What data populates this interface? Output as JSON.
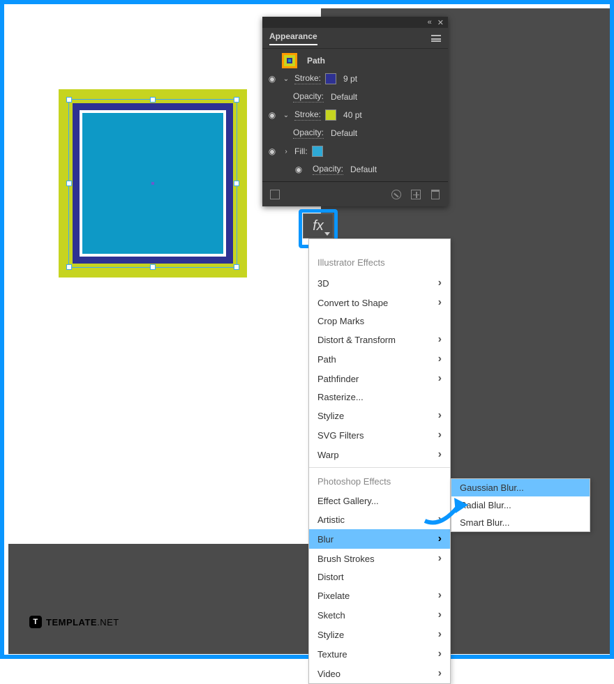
{
  "panel": {
    "title": "Appearance",
    "target": "Path",
    "rows": [
      {
        "kind": "stroke",
        "label": "Stroke:",
        "color": "#2e3192",
        "value": "9 pt"
      },
      {
        "kind": "opacity",
        "label": "Opacity:",
        "value": "Default"
      },
      {
        "kind": "stroke",
        "label": "Stroke:",
        "color": "#c6d420",
        "value": "40 pt"
      },
      {
        "kind": "opacity",
        "label": "Opacity:",
        "value": "Default"
      },
      {
        "kind": "fill",
        "label": "Fill:",
        "color": "#2ea9d6"
      },
      {
        "kind": "opacity",
        "label": "Opacity:",
        "value": "Default"
      }
    ],
    "fx": "fx"
  },
  "menu": {
    "section1": "Illustrator Effects",
    "items1": [
      {
        "label": "3D",
        "arrow": true
      },
      {
        "label": "Convert to Shape",
        "arrow": true
      },
      {
        "label": "Crop Marks",
        "arrow": false
      },
      {
        "label": "Distort & Transform",
        "arrow": true
      },
      {
        "label": "Path",
        "arrow": true
      },
      {
        "label": "Pathfinder",
        "arrow": true
      },
      {
        "label": "Rasterize...",
        "arrow": false
      },
      {
        "label": "Stylize",
        "arrow": true
      },
      {
        "label": "SVG Filters",
        "arrow": true
      },
      {
        "label": "Warp",
        "arrow": true
      }
    ],
    "section2": "Photoshop Effects",
    "items2": [
      {
        "label": "Effect Gallery...",
        "arrow": false
      },
      {
        "label": "Artistic",
        "arrow": true
      },
      {
        "label": "Blur",
        "arrow": true,
        "hover": true
      },
      {
        "label": "Brush Strokes",
        "arrow": true
      },
      {
        "label": "Distort",
        "arrow": false
      },
      {
        "label": "Pixelate",
        "arrow": true
      },
      {
        "label": "Sketch",
        "arrow": true
      },
      {
        "label": "Stylize",
        "arrow": true
      },
      {
        "label": "Texture",
        "arrow": true
      },
      {
        "label": "Video",
        "arrow": true
      }
    ],
    "submenu": [
      {
        "label": "Gaussian Blur...",
        "hover": true
      },
      {
        "label": "Radial Blur..."
      },
      {
        "label": "Smart Blur..."
      }
    ]
  },
  "brand": {
    "mark": "T",
    "name": "TEMPLATE",
    "suffix": ".NET"
  }
}
